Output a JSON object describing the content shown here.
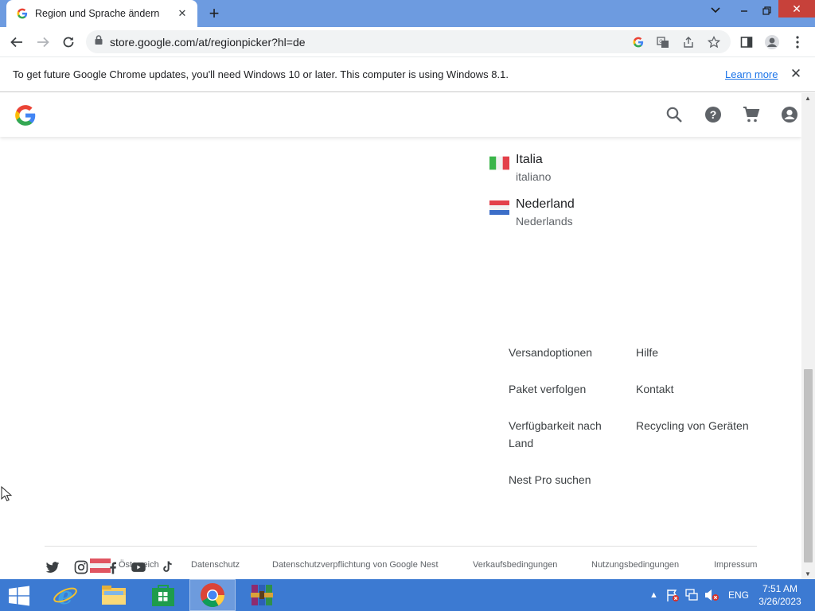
{
  "browser": {
    "tab_title": "Region und Sprache ändern",
    "url": "store.google.com/at/regionpicker?hl=de"
  },
  "infobar": {
    "message": "To get future Google Chrome updates, you'll need Windows 10 or later. This computer is using Windows 8.1.",
    "link": "Learn more"
  },
  "regions": [
    {
      "country": "Italia",
      "language": "italiano",
      "flag": "italy"
    },
    {
      "country": "Nederland",
      "language": "Nederlands",
      "flag": "netherlands"
    }
  ],
  "footer": {
    "links_col1": [
      "Versandoptionen",
      "Paket verfolgen",
      "Verfügbarkeit nach Land",
      "Nest Pro suchen"
    ],
    "links_col2": [
      "Hilfe",
      "Kontakt",
      "Recycling von Geräten"
    ],
    "country_label": "Österreich",
    "legal": [
      "Datenschutz",
      "Datenschutzverpflichtung von Google Nest",
      "Verkaufsbedingungen",
      "Nutzungsbedingungen",
      "Impressum"
    ]
  },
  "taskbar": {
    "lang": "ENG",
    "time": "7:51 AM",
    "date": "3/26/2023"
  },
  "colors": {
    "tab_strip": "#6d9be0",
    "taskbar": "#3c7ad2",
    "link_blue": "#1a73e8"
  }
}
